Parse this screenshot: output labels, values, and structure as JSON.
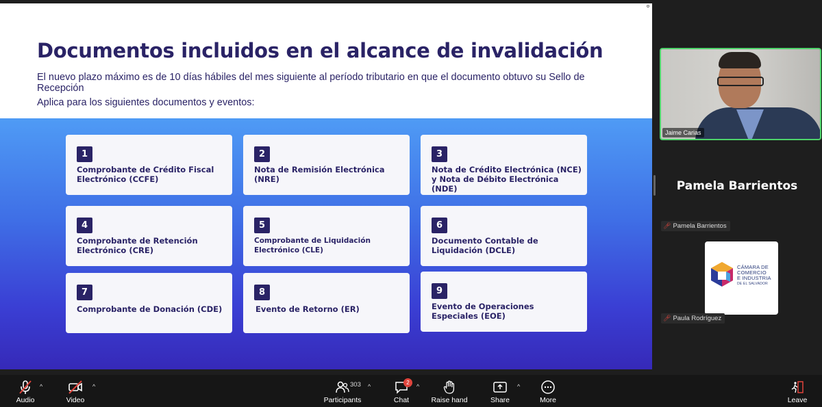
{
  "slide": {
    "title": "Documentos incluidos en el alcance de invalidación",
    "subtitle": "El nuevo plazo máximo es de 10 días hábiles del mes siguiente al período tributario en que el documento obtuvo su Sello de Recepción",
    "subtitle2": "Aplica para los siguientes documentos y eventos:",
    "cards": [
      {
        "num": "1",
        "text": "Comprobante de Crédito Fiscal Electrónico (CCFE)"
      },
      {
        "num": "2",
        "text": "Nota de Remisión Electrónica (NRE)"
      },
      {
        "num": "3",
        "text": "Nota de Crédito Electrónica (NCE) y Nota de Débito Electrónica (NDE)"
      },
      {
        "num": "4",
        "text": "Comprobante de Retención Electrónico (CRE)"
      },
      {
        "num": "5",
        "text": "Comprobante de Liquidación Electrónico (CLE)"
      },
      {
        "num": "6",
        "text": "Documento Contable de Liquidación (DCLE)"
      },
      {
        "num": "7",
        "text": "Comprobante de Donación (CDE)"
      },
      {
        "num": "8",
        "text": "Evento de Retorno (ER)"
      },
      {
        "num": "9",
        "text": "Evento de Operaciones Especiales (EOE)"
      }
    ]
  },
  "panel": {
    "video_name": "Jaime Carias",
    "active_speaker": "Pamela Barrientos",
    "tile1_label": "Pamela Barrientos",
    "tile2_label": "Paula Rodríguez",
    "logo": {
      "line1": "CÁMARA DE",
      "line2": "COMERCIO",
      "line3": "E INDUSTRIA",
      "line4": "DE EL SALVADOR"
    }
  },
  "toolbar": {
    "audio": "Audio",
    "video": "Video",
    "participants": "Participants",
    "participants_count": "303",
    "chat": "Chat",
    "chat_badge": "2",
    "raise_hand": "Raise hand",
    "share": "Share",
    "more": "More",
    "leave": "Leave"
  },
  "colors": {
    "title": "#2a2366",
    "active_border": "#4ed46a",
    "muted": "#e0443c"
  }
}
